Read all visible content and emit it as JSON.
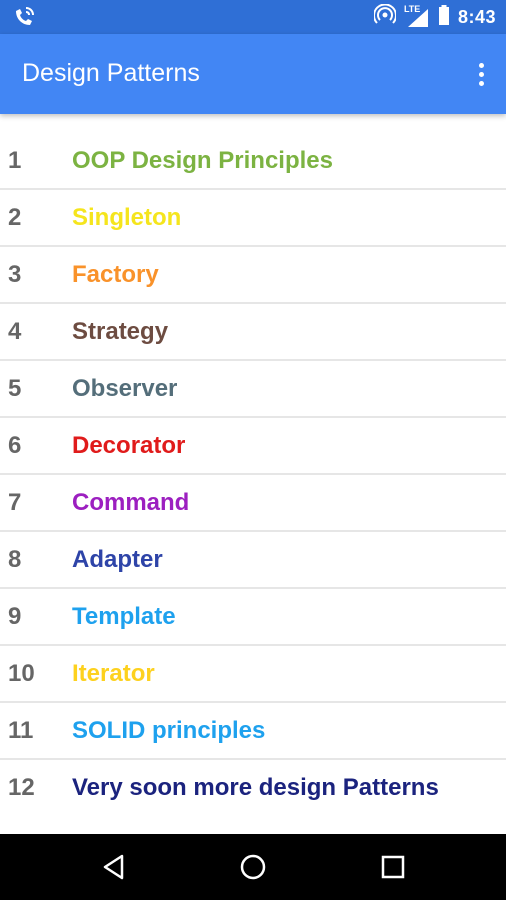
{
  "status_bar": {
    "time": "8:43",
    "network_label": "LTE",
    "icons": [
      "phone-notification-icon",
      "hotspot-icon",
      "signal-icon",
      "battery-icon"
    ]
  },
  "app_bar": {
    "title": "Design Patterns",
    "menu_icon": "overflow-menu-icon",
    "background": "#4286f4"
  },
  "list": {
    "items": [
      {
        "number": "1",
        "label": "OOP Design Principles",
        "color": "#7cb342"
      },
      {
        "number": "2",
        "label": "Singleton",
        "color": "#f5e51d"
      },
      {
        "number": "3",
        "label": "Factory",
        "color": "#f9922a"
      },
      {
        "number": "4",
        "label": "Strategy",
        "color": "#6d4c41"
      },
      {
        "number": "5",
        "label": "Observer",
        "color": "#546e7a"
      },
      {
        "number": "6",
        "label": "Decorator",
        "color": "#e01b1b"
      },
      {
        "number": "7",
        "label": "Command",
        "color": "#9c1fc0"
      },
      {
        "number": "8",
        "label": "Adapter",
        "color": "#2e44a8"
      },
      {
        "number": "9",
        "label": "Template",
        "color": "#1ea1ee"
      },
      {
        "number": "10",
        "label": "Iterator",
        "color": "#fdd11e"
      },
      {
        "number": "11",
        "label": "SOLID principles",
        "color": "#1ea1ee"
      },
      {
        "number": "12",
        "label": "Very soon more design Patterns",
        "color": "#1b237e"
      }
    ]
  },
  "nav_bar": {
    "icons": [
      "back-icon",
      "home-icon",
      "recents-icon"
    ]
  }
}
